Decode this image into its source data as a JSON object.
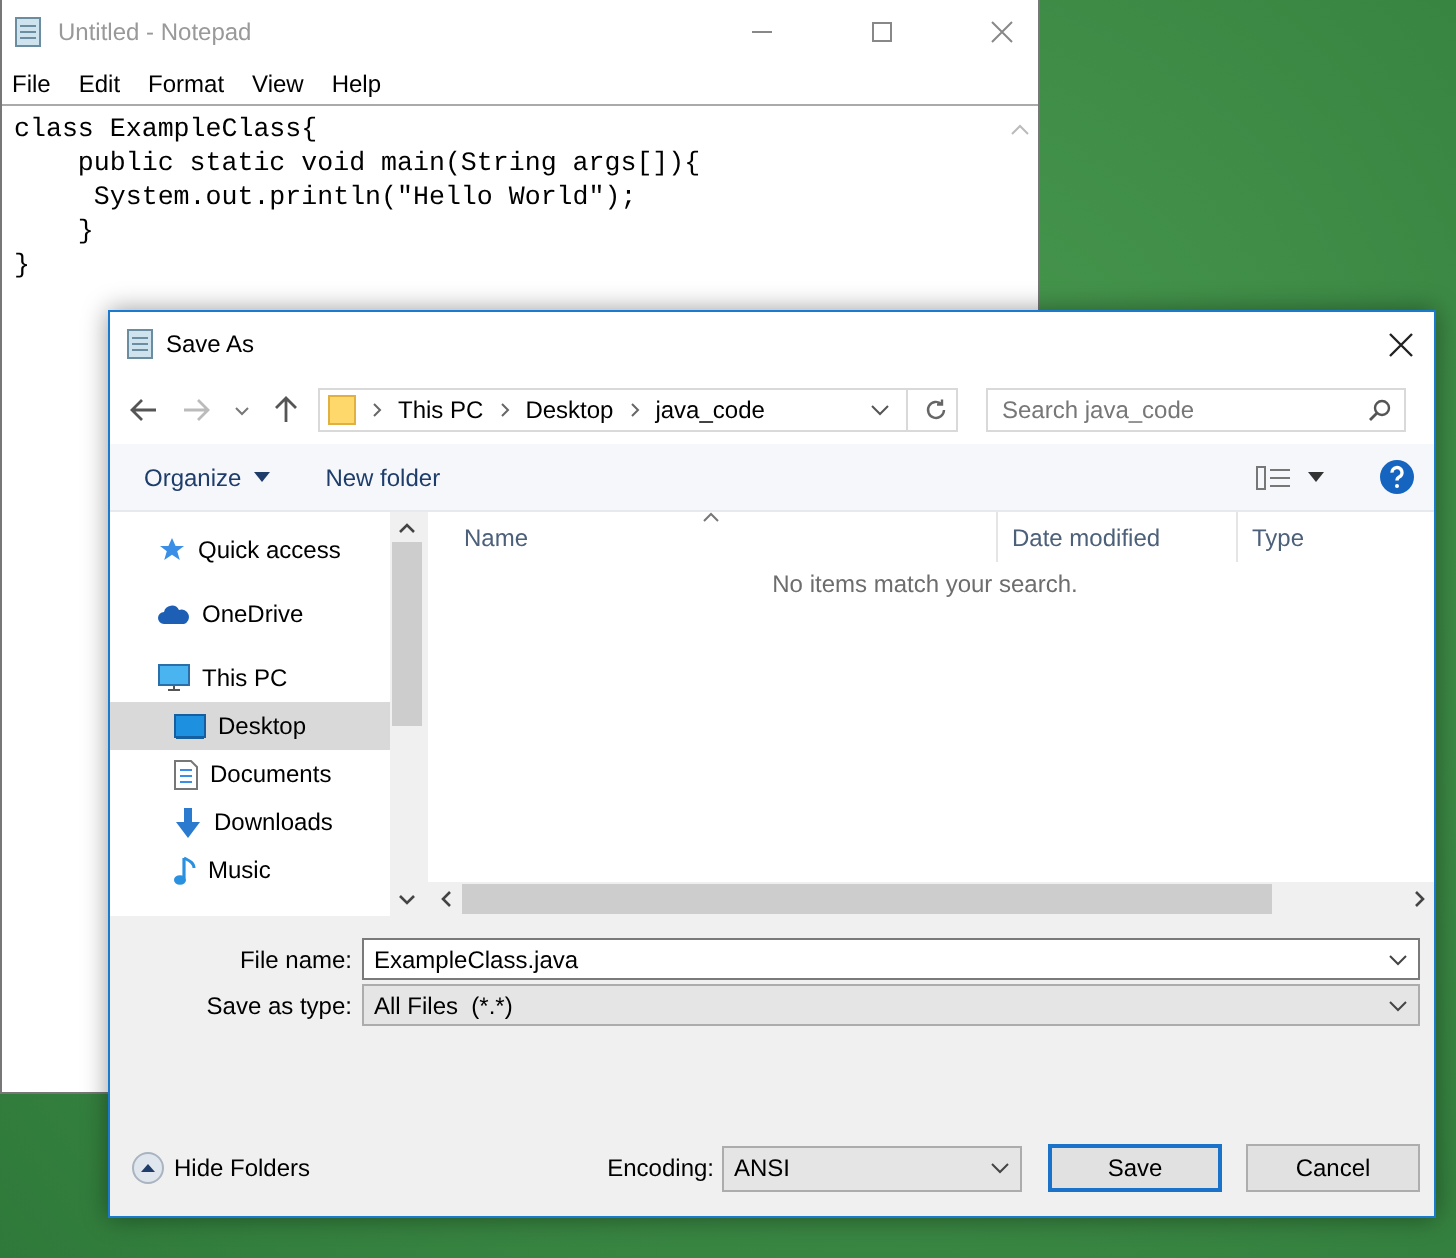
{
  "notepad": {
    "title": "Untitled - Notepad",
    "menu": [
      "File",
      "Edit",
      "Format",
      "View",
      "Help"
    ],
    "text": "class ExampleClass{\n    public static void main(String args[]){\n     System.out.println(\"Hello World\");\n    }\n}"
  },
  "dialog": {
    "title": "Save As",
    "breadcrumb": [
      "This PC",
      "Desktop",
      "java_code"
    ],
    "search": {
      "placeholder": "Search java_code"
    },
    "toolbar": {
      "organize": "Organize",
      "new_folder": "New folder"
    },
    "nav": [
      {
        "label": "Quick access",
        "kind": "star",
        "selected": false
      },
      {
        "label": "OneDrive",
        "kind": "cloud",
        "selected": false
      },
      {
        "label": "This PC",
        "kind": "pc",
        "selected": false,
        "children": [
          {
            "label": "Desktop",
            "kind": "desktop",
            "selected": true
          },
          {
            "label": "Documents",
            "kind": "document",
            "selected": false
          },
          {
            "label": "Downloads",
            "kind": "download",
            "selected": false
          },
          {
            "label": "Music",
            "kind": "music",
            "selected": false
          }
        ]
      }
    ],
    "columns": [
      "Name",
      "Date modified",
      "Type"
    ],
    "empty_message": "No items match your search.",
    "file_name": {
      "label": "File name:",
      "value": "ExampleClass.java"
    },
    "save_type": {
      "label": "Save as type:",
      "value": "All Files  (*.*)"
    },
    "hide_folders": "Hide Folders",
    "encoding": {
      "label": "Encoding:",
      "value": "ANSI"
    },
    "buttons": [
      {
        "label": "Save",
        "default": true
      },
      {
        "label": "Cancel",
        "default": false
      }
    ]
  }
}
